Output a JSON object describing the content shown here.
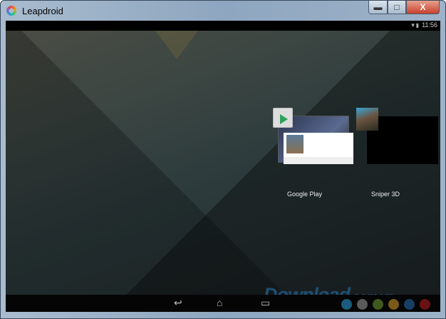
{
  "window": {
    "title": "Leapdroid",
    "minimize": "▬",
    "maximize": "□",
    "close": "X"
  },
  "status_bar": {
    "time": "11:56",
    "icons": [
      "wifi-icon",
      "battery-icon"
    ]
  },
  "recents": [
    {
      "label": "Google Play"
    },
    {
      "label": "Sniper 3D"
    }
  ],
  "navbar": {
    "back": "↩",
    "home": "⌂",
    "recents": "▭"
  },
  "colors": [
    "#1a5b7e",
    "#5a5a5a",
    "#3f5a1e",
    "#7a5a18",
    "#163f63",
    "#6a1212"
  ],
  "watermark": {
    "main": "Download",
    "suffix": ".com.vn"
  }
}
